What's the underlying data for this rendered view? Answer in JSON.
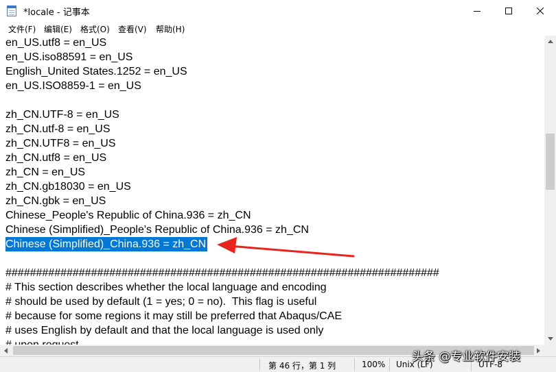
{
  "window": {
    "title": "*locale - 记事本",
    "app_icon": "notepad-icon",
    "controls": [
      "minimize-icon",
      "maximize-icon",
      "close-icon"
    ]
  },
  "menu": [
    {
      "label": "文件(F)"
    },
    {
      "label": "编辑(E)"
    },
    {
      "label": "格式(O)"
    },
    {
      "label": "查看(V)"
    },
    {
      "label": "帮助(H)"
    }
  ],
  "editor": {
    "lines": [
      "en_US.utf8 = en_US",
      "en_US.iso88591 = en_US",
      "English_United States.1252 = en_US",
      "en_US.ISO8859-1 = en_US",
      "",
      "zh_CN.UTF-8 = en_US",
      "zh_CN.utf-8 = en_US",
      "zh_CN.UTF8 = en_US",
      "zh_CN.utf8 = en_US",
      "zh_CN = en_US",
      "zh_CN.gb18030 = en_US",
      "zh_CN.gbk = en_US",
      "Chinese_People's Republic of China.936 = zh_CN",
      "Chinese (Simplified)_People's Republic of China.936 = zh_CN",
      "Chinese (Simplified)_China.936 = zh_CN",
      "",
      "#######################################################################",
      "# This section describes whether the local language and encoding",
      "# should be used by default (1 = yes; 0 = no).  This flag is useful",
      "# because for some regions it may still be preferred that Abaqus/CAE",
      "# uses English by default and that the local language is used only",
      "# upon request."
    ],
    "selected_line_index": 14,
    "selection_color": "#0078d7",
    "annotation_color": "#e8231e"
  },
  "status": {
    "position": "第 46 行，第 1 列",
    "zoom": "100%",
    "line_ending": "Unix (LF)",
    "encoding": "UTF-8"
  },
  "watermark": "头条 @专业软件安装"
}
